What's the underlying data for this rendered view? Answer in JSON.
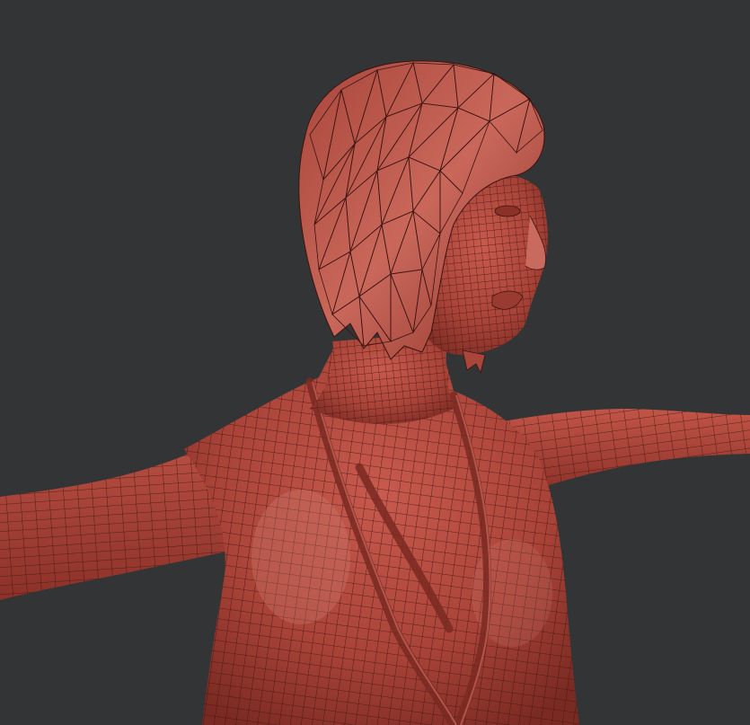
{
  "viewport": {
    "background": "#333435",
    "mesh_color": "#b24a40",
    "mesh_highlight": "#d9897d",
    "wire_color": "#3a1410",
    "wireframe_visible": true
  }
}
